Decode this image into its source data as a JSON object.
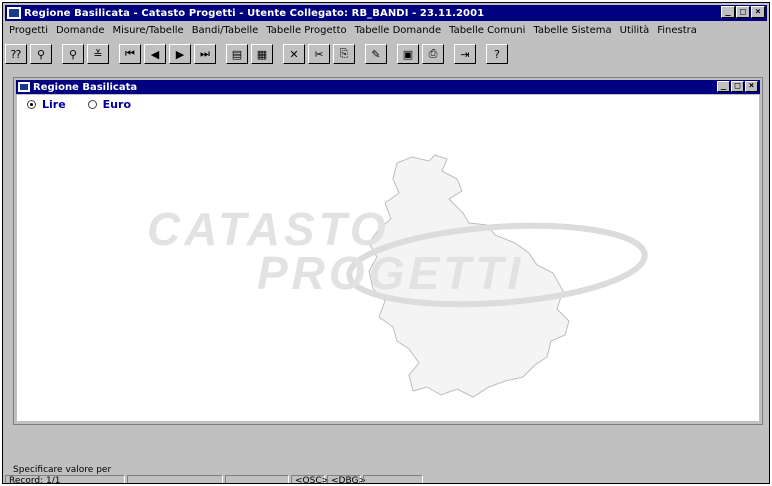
{
  "app": {
    "title": "Regione Basilicata - Catasto Progetti - Utente Collegato: RB_BANDI - 23.11.2001",
    "window_buttons": [
      "_",
      "□",
      "×"
    ]
  },
  "menu": [
    "Progetti",
    "Domande",
    "Misure/Tabelle",
    "Bandi/Tabelle",
    "Tabelle Progetto",
    "Tabelle Domande",
    "Tabelle Comuni",
    "Tabelle Sistema",
    "Utilità",
    "Finestra"
  ],
  "toolbar": {
    "buttons": [
      {
        "name": "query-find-icon",
        "glyph": "⁇"
      },
      {
        "name": "binoculars-icon",
        "glyph": "⚲"
      },
      {
        "name": "binoculars-red-icon",
        "glyph": "⚲"
      },
      {
        "name": "filter-icon",
        "glyph": "≚"
      },
      {
        "name": "first-record-icon",
        "glyph": "⏮"
      },
      {
        "name": "previous-record-icon",
        "glyph": "◀"
      },
      {
        "name": "next-record-icon",
        "glyph": "▶"
      },
      {
        "name": "last-record-icon",
        "glyph": "⏭"
      },
      {
        "name": "new-record-icon",
        "glyph": "▤"
      },
      {
        "name": "edit-record-icon",
        "glyph": "▦"
      },
      {
        "name": "delete-record-icon",
        "glyph": "✕"
      },
      {
        "name": "cut-icon",
        "glyph": "✂"
      },
      {
        "name": "copy-icon",
        "glyph": "⎘"
      },
      {
        "name": "paste-icon",
        "glyph": "✎"
      },
      {
        "name": "save-icon",
        "glyph": "▣"
      },
      {
        "name": "print-icon",
        "glyph": "⎙"
      },
      {
        "name": "exit-icon",
        "glyph": "⇥"
      },
      {
        "name": "help-icon",
        "glyph": "?"
      }
    ]
  },
  "child_window": {
    "title": "Regione Basilicata",
    "radio_options": [
      {
        "label": "Lire",
        "selected": true
      },
      {
        "label": "Euro",
        "selected": false
      }
    ],
    "watermark": {
      "line1": "CATASTO",
      "line2": "PROGETTI"
    }
  },
  "status": {
    "message": "Specificare valore per",
    "record": "Record: 1/1",
    "osc": "<OSC>",
    "dbg": "<DBG>"
  }
}
